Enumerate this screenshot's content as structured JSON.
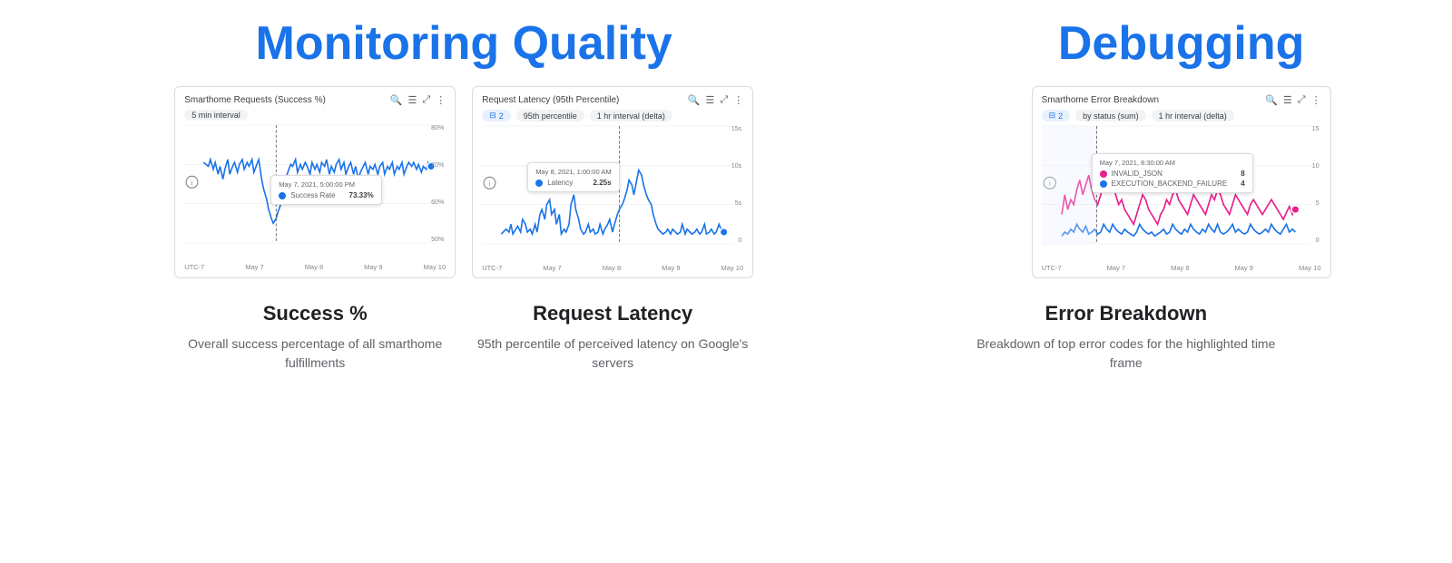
{
  "header": {
    "left_title": "Monitoring Quality",
    "right_title": "Debugging"
  },
  "charts": [
    {
      "id": "success-rate",
      "title": "Smarthome Requests (Success %)",
      "filters": [
        "5 min interval"
      ],
      "y_labels": [
        "80%",
        "70%",
        "60%",
        "50%"
      ],
      "x_labels": [
        "UTC-7",
        "May 7",
        "May 8",
        "May 9",
        "May 10"
      ],
      "tooltip_date": "May 7, 2021, 5:00:00 PM",
      "tooltip_series": "Success Rate",
      "tooltip_value": "73.33%",
      "tooltip_color": "#1a73e8",
      "subtitle": "Success %",
      "description": "Overall success percentage of all smarthome fulfillments"
    },
    {
      "id": "request-latency",
      "title": "Request Latency (95th Percentile)",
      "filters": [
        "2",
        "95th percentile",
        "1 hr interval (delta)"
      ],
      "y_labels": [
        "15s",
        "10s",
        "5s",
        "0"
      ],
      "x_labels": [
        "UTC-7",
        "May 7",
        "May 8",
        "May 9",
        "May 10"
      ],
      "tooltip_date": "May 8, 2021, 1:00:00 AM",
      "tooltip_series": "Latency",
      "tooltip_value": "2.25s",
      "tooltip_color": "#1a73e8",
      "subtitle": "Request Latency",
      "description": "95th percentile of perceived latency on Google's servers"
    }
  ],
  "debug_chart": {
    "id": "error-breakdown",
    "title": "Smarthome Error Breakdown",
    "filters": [
      "2",
      "by status (sum)",
      "1 hr interval (delta)"
    ],
    "y_labels": [
      "15",
      "10",
      "5",
      "0"
    ],
    "x_labels": [
      "UTC-7",
      "May 7",
      "May 8",
      "May 9",
      "May 10"
    ],
    "tooltip_date": "May 7, 2021, 8:30:00 AM",
    "tooltip_series1": "INVALID_JSON",
    "tooltip_value1": "8",
    "tooltip_color1": "#e91e8c",
    "tooltip_series2": "EXECUTION_BACKEND_FAILURE",
    "tooltip_value2": "4",
    "tooltip_color2": "#1a73e8",
    "subtitle": "Error Breakdown",
    "description": "Breakdown of top error codes for the highlighted time frame"
  },
  "icons": {
    "search": "🔍",
    "legend": "≡",
    "expand": "⤢",
    "more": "⋮",
    "filter": "⊟"
  }
}
